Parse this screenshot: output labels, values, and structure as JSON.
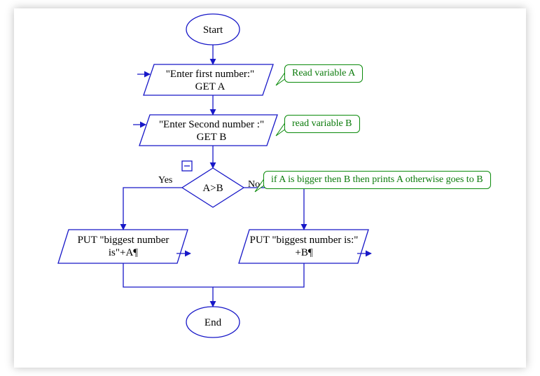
{
  "nodes": {
    "start": "Start",
    "input_a_line1": "\"Enter first number:\"",
    "input_a_line2": "GET A",
    "input_b_line1": "\"Enter Second number :\"",
    "input_b_line2": "GET B",
    "decision": "A>B",
    "output_a_line1": "PUT \"biggest number",
    "output_a_line2": "is\"+A¶",
    "output_b_line1": "PUT \"biggest number is:\"",
    "output_b_line2": "+B¶",
    "end": "End"
  },
  "edges": {
    "yes": "Yes",
    "no": "No"
  },
  "annotations": {
    "read_a": "Read variable A",
    "read_b": "read variable B",
    "decision_note": "if A is bigger then B then prints A otherwise goes to B"
  },
  "colors": {
    "shape_stroke": "#1818c8",
    "annotation": "#0a8a0a"
  }
}
